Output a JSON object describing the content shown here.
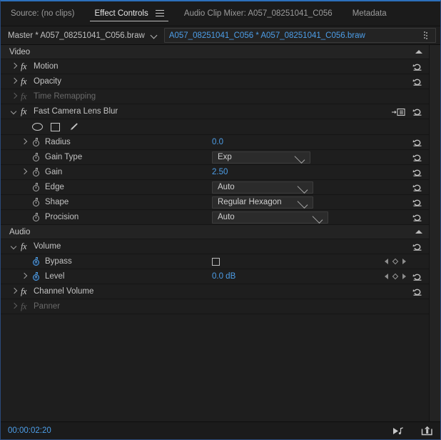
{
  "window": {
    "accent_color": "#4d9ee8",
    "background": "#1e1e1e"
  },
  "tabbar": {
    "tabs": [
      {
        "label": "Source: (no clips)",
        "active": false
      },
      {
        "label": "Effect Controls",
        "active": true
      },
      {
        "label": "Audio Clip Mixer: A057_08251041_C056",
        "active": false
      },
      {
        "label": "Metadata",
        "active": false
      }
    ],
    "panel_menu_icon": "hamburger-menu-icon"
  },
  "master_bar": {
    "master_label": "Master * A057_08251041_C056.braw",
    "dropdown_icon": "chevron-down-icon",
    "clip_field_value": "A057_08251041_C056 * A057_08251041_C056.braw",
    "grip_icon": "drag-grip-icon"
  },
  "video_section": {
    "title": "Video",
    "collapse_icon": "triangle-up-icon",
    "effects": [
      {
        "name": "Motion",
        "twisty": "closed",
        "dimmed": false,
        "reset": true
      },
      {
        "name": "Opacity",
        "twisty": "closed",
        "dimmed": false,
        "reset": true
      },
      {
        "name": "Time Remapping",
        "twisty": "closed",
        "dimmed": true,
        "reset": false
      },
      {
        "name": "Fast Camera Lens Blur",
        "twisty": "open",
        "dimmed": false,
        "reset": true,
        "layout_icon": "effect-layout-icon"
      }
    ],
    "mask_tools": [
      {
        "name": "ellipse-mask-icon"
      },
      {
        "name": "rectangle-mask-icon"
      },
      {
        "name": "pen-mask-icon"
      }
    ],
    "parameters": [
      {
        "label": "Radius",
        "twisty": "closed",
        "stopwatch": "off",
        "control": "number",
        "value": "0.0"
      },
      {
        "label": "Gain Type",
        "twisty": "none",
        "stopwatch": "off",
        "control": "dropdown",
        "value": "Exp",
        "width": 138
      },
      {
        "label": "Gain",
        "twisty": "closed",
        "stopwatch": "off",
        "control": "number",
        "value": "2.50"
      },
      {
        "label": "Edge",
        "twisty": "none",
        "stopwatch": "off",
        "control": "dropdown",
        "value": "Auto",
        "width": 142
      },
      {
        "label": "Shape",
        "twisty": "none",
        "stopwatch": "off",
        "control": "dropdown",
        "value": "Regular Hexagon",
        "width": 142
      },
      {
        "label": "Procision",
        "twisty": "none",
        "stopwatch": "off",
        "control": "dropdown",
        "value": "Auto",
        "width": 163
      }
    ]
  },
  "audio_section": {
    "title": "Audio",
    "collapse_icon": "triangle-up-icon",
    "effects": [
      {
        "name": "Volume",
        "twisty": "open",
        "dimmed": false,
        "reset": true
      },
      {
        "name": "Channel Volume",
        "twisty": "closed",
        "dimmed": false,
        "reset": true
      },
      {
        "name": "Panner",
        "twisty": "closed",
        "dimmed": true,
        "reset": false
      }
    ],
    "volume_parameters": [
      {
        "label": "Bypass",
        "twisty": "none",
        "stopwatch": "on",
        "control": "checkbox",
        "value": "",
        "checked": false,
        "keyframe_nav": true,
        "reset": false
      },
      {
        "label": "Level",
        "twisty": "closed",
        "stopwatch": "on",
        "control": "number",
        "value": "0.0 dB",
        "keyframe_nav": true,
        "reset": true
      }
    ]
  },
  "bottom_bar": {
    "timecode": "00:00:02:20",
    "icons": [
      {
        "name": "play-audio-icon"
      },
      {
        "name": "export-frame-icon"
      }
    ]
  }
}
